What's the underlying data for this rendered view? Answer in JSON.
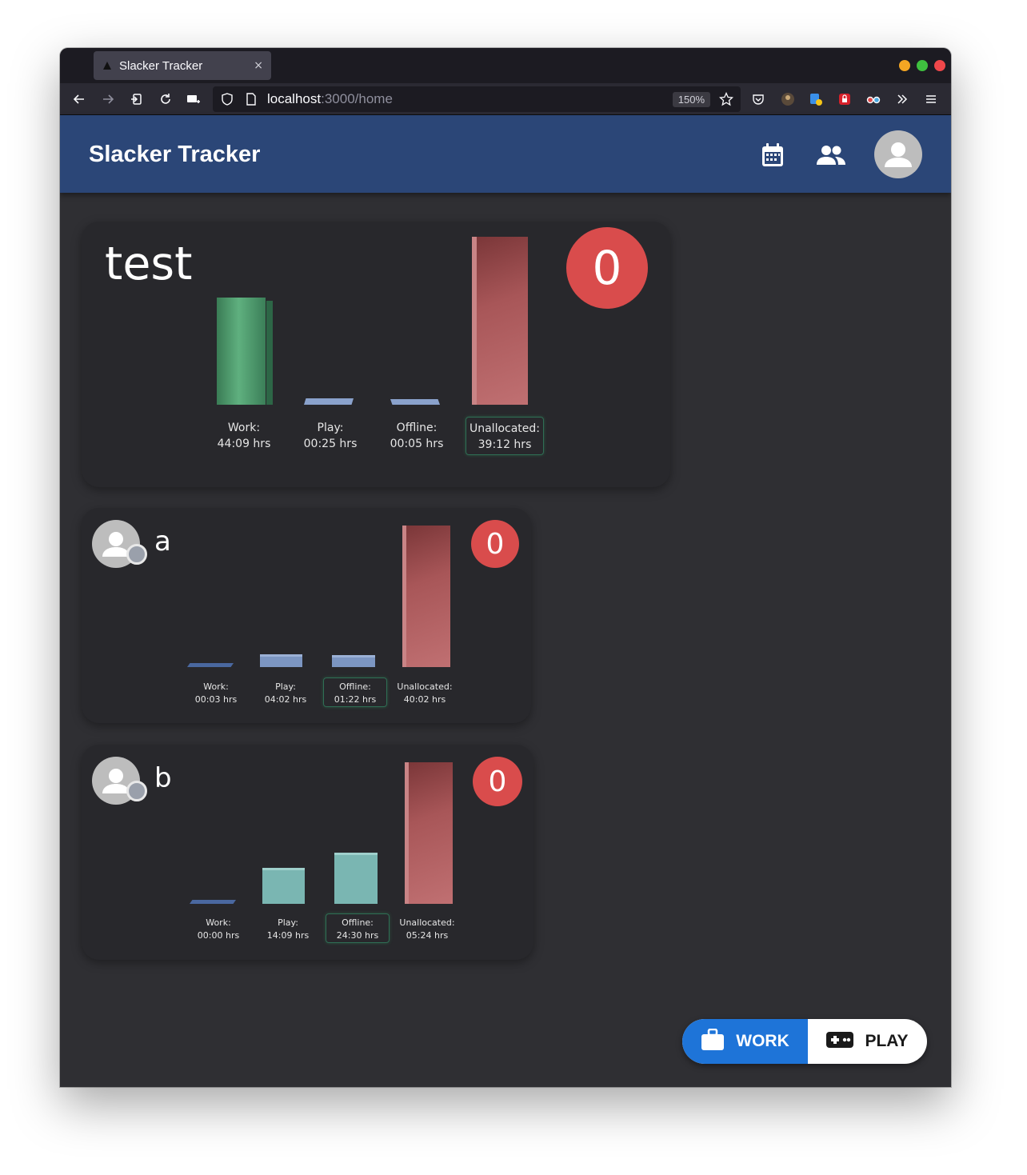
{
  "browser": {
    "tab_title": "Slacker Tracker",
    "tab_close": "×",
    "url_host": "localhost",
    "url_path": ":3000/home",
    "zoom": "150%"
  },
  "app": {
    "title": "Slacker Tracker",
    "nav_icons": [
      "calendar-icon",
      "people-icon",
      "account-icon"
    ]
  },
  "colors": {
    "header": "#2b4677",
    "background": "#2f2f33",
    "card": "#28282c",
    "badge": "#d94c4c",
    "work": "#3e8a5e",
    "play": "#7a9ac6",
    "offline": "#7ab8b4",
    "unallocated": "#b8686a",
    "toggle_active": "#1e74d8"
  },
  "team": {
    "name": "test",
    "badge": "0",
    "bars": [
      {
        "title": "Work:",
        "value": "44:09 hrs",
        "hours": 44.15
      },
      {
        "title": "Play:",
        "value": "00:25 hrs",
        "hours": 0.42
      },
      {
        "title": "Offline:",
        "value": "00:05 hrs",
        "hours": 0.08
      },
      {
        "title": "Unallocated:",
        "value": "39:12 hrs",
        "hours": 39.2
      }
    ]
  },
  "members": [
    {
      "name": "a",
      "badge": "0",
      "bars": [
        {
          "title": "Work:",
          "value": "00:03 hrs",
          "hours": 0.05
        },
        {
          "title": "Play:",
          "value": "04:02 hrs",
          "hours": 4.03
        },
        {
          "title": "Offline:",
          "value": "01:22 hrs",
          "hours": 1.37
        },
        {
          "title": "Unallocated:",
          "value": "40:02 hrs",
          "hours": 40.03
        }
      ]
    },
    {
      "name": "b",
      "badge": "0",
      "bars": [
        {
          "title": "Work:",
          "value": "00:00 hrs",
          "hours": 0
        },
        {
          "title": "Play:",
          "value": "14:09 hrs",
          "hours": 14.15
        },
        {
          "title": "Offline:",
          "value": "24:30 hrs",
          "hours": 24.5
        },
        {
          "title": "Unallocated:",
          "value": "05:24 hrs",
          "hours": 5.4
        }
      ]
    }
  ],
  "mode_toggle": {
    "work_label": "WORK",
    "play_label": "PLAY",
    "active": "work"
  }
}
